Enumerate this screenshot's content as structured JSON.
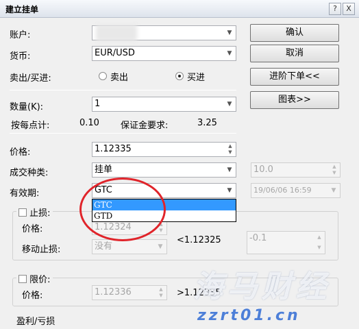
{
  "window": {
    "title": "建立挂单",
    "help_glyph": "?",
    "close_glyph": "X"
  },
  "account": {
    "label": "账户:",
    "value": ""
  },
  "currency": {
    "label": "货币:",
    "value": "EUR/USD"
  },
  "side": {
    "label": "卖出/买进:",
    "sell_label": "卖出",
    "buy_label": "买进",
    "selected": "buy"
  },
  "quantity": {
    "label": "数量(K):",
    "value": "1"
  },
  "per_point": {
    "label": "按每点计:",
    "value": "0.10"
  },
  "margin": {
    "label": "保证金要求:",
    "value": "3.25"
  },
  "price": {
    "label": "价格:",
    "value": "1.12335"
  },
  "order_type": {
    "label": "成交种类:",
    "value": "挂单",
    "side_value": "10.0"
  },
  "validity": {
    "label": "有效期:",
    "value": "GTC",
    "datetime": "19/06/06 16:59",
    "options": [
      "GTC",
      "GTD"
    ],
    "highlighted": "GTC"
  },
  "stop_loss": {
    "label": "止损:",
    "price_label": "价格:",
    "price_value": "1.12324",
    "trailing_label": "移动止损:",
    "trailing_value": "没有",
    "bound": "<1.12325",
    "offset": "-0.1"
  },
  "limit": {
    "label": "限价:",
    "price_label": "价格:",
    "price_value": "1.12336",
    "bound": ">1.12335"
  },
  "pnl": {
    "label": "盈利/亏损"
  },
  "buttons": {
    "confirm": "确认",
    "cancel": "取消",
    "advanced": "进阶下单<<",
    "chart": "图表>>"
  },
  "watermark": {
    "text": "海马财经",
    "url": "zzrt01.cn"
  }
}
